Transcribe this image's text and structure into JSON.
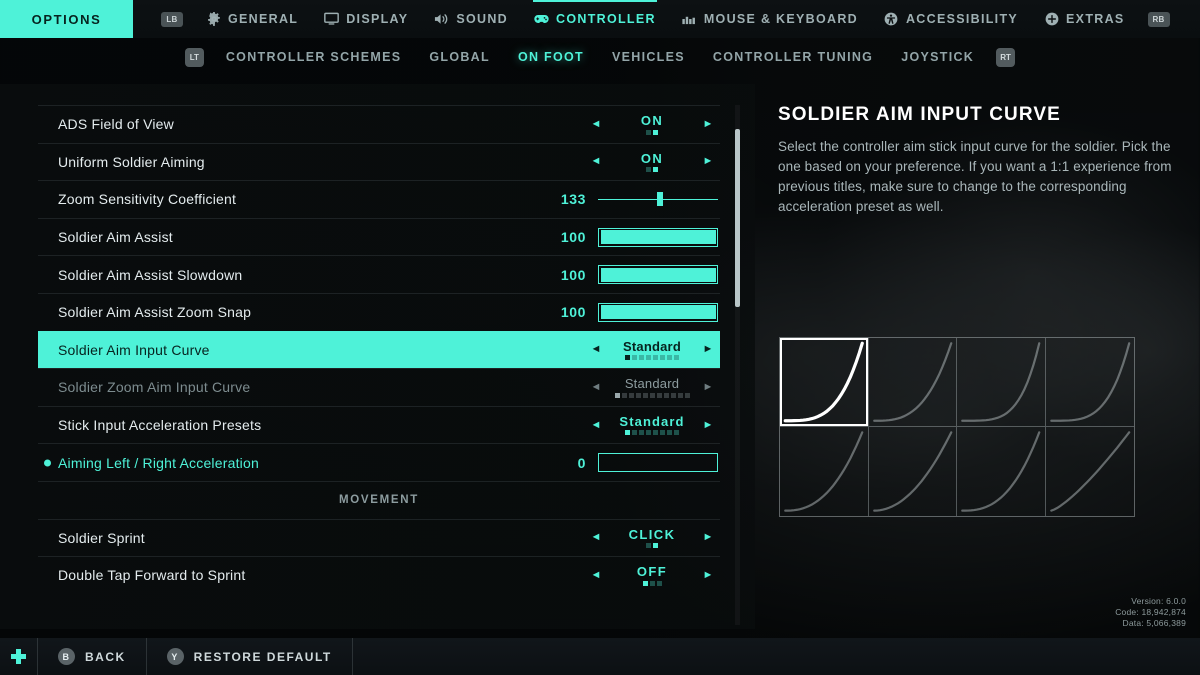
{
  "topnav": {
    "options_label": "OPTIONS",
    "left_bumper": "LB",
    "right_bumper": "RB",
    "items": [
      {
        "label": "GENERAL",
        "icon": "gear-icon",
        "active": false
      },
      {
        "label": "DISPLAY",
        "icon": "monitor-icon",
        "active": false
      },
      {
        "label": "SOUND",
        "icon": "speaker-icon",
        "active": false
      },
      {
        "label": "CONTROLLER",
        "icon": "gamepad-icon",
        "active": true
      },
      {
        "label": "MOUSE & KEYBOARD",
        "icon": "keyboard-icon",
        "active": false
      },
      {
        "label": "ACCESSIBILITY",
        "icon": "accessibility-icon",
        "active": false
      },
      {
        "label": "EXTRAS",
        "icon": "plus-circle-icon",
        "active": false
      }
    ]
  },
  "subnav": {
    "left_trigger": "LT",
    "right_trigger": "RT",
    "items": [
      {
        "label": "CONTROLLER SCHEMES",
        "active": false
      },
      {
        "label": "GLOBAL",
        "active": false
      },
      {
        "label": "ON FOOT",
        "active": true
      },
      {
        "label": "VEHICLES",
        "active": false
      },
      {
        "label": "CONTROLLER TUNING",
        "active": false
      },
      {
        "label": "JOYSTICK",
        "active": false
      }
    ]
  },
  "settings": {
    "rows": [
      {
        "type": "option",
        "label": "ADS Field of View",
        "value": "ON",
        "pips_total": 2,
        "pips_index": 1,
        "state": "normal"
      },
      {
        "type": "option",
        "label": "Uniform Soldier Aiming",
        "value": "ON",
        "pips_total": 2,
        "pips_index": 1,
        "state": "normal"
      },
      {
        "type": "slider",
        "label": "Zoom Sensitivity Coefficient",
        "value": "133",
        "percent": 52,
        "state": "normal"
      },
      {
        "type": "meter",
        "label": "Soldier Aim Assist",
        "value": "100",
        "percent": 100,
        "state": "normal"
      },
      {
        "type": "meter",
        "label": "Soldier Aim Assist Slowdown",
        "value": "100",
        "percent": 100,
        "state": "normal"
      },
      {
        "type": "meter",
        "label": "Soldier Aim Assist Zoom Snap",
        "value": "100",
        "percent": 100,
        "state": "normal"
      },
      {
        "type": "option",
        "label": "Soldier Aim Input Curve",
        "value": "Standard",
        "pips_total": 8,
        "pips_index": 0,
        "state": "selected"
      },
      {
        "type": "option",
        "label": "Soldier Zoom Aim Input Curve",
        "value": "Standard",
        "pips_total": 11,
        "pips_index": 0,
        "state": "dim"
      },
      {
        "type": "option",
        "label": "Stick Input Acceleration Presets",
        "value": "Standard",
        "pips_total": 8,
        "pips_index": 0,
        "state": "normal"
      },
      {
        "type": "meter",
        "label": "Aiming Left / Right Acceleration",
        "value": "0",
        "percent": 0,
        "state": "accent",
        "bullet": true
      },
      {
        "type": "section",
        "label": "MOVEMENT"
      },
      {
        "type": "option",
        "label": "Soldier Sprint",
        "value": "CLICK",
        "pips_total": 2,
        "pips_index": 1,
        "state": "normal"
      },
      {
        "type": "option",
        "label": "Double Tap Forward to Sprint",
        "value": "OFF",
        "pips_total": 3,
        "pips_index": 0,
        "state": "normal"
      }
    ]
  },
  "info": {
    "title": "SOLDIER AIM INPUT CURVE",
    "description": "Select the controller aim stick input curve for the soldier. Pick the one based on your preference. If you want a 1:1 experience from previous titles, make sure to change to the corresponding acceleration preset as well.",
    "curves": [
      {
        "name": "curve-1",
        "exponent": 3.4,
        "active": true
      },
      {
        "name": "curve-2",
        "exponent": 3.0,
        "active": false
      },
      {
        "name": "curve-3",
        "exponent": 4.2,
        "active": false
      },
      {
        "name": "curve-4",
        "exponent": 3.8,
        "active": false
      },
      {
        "name": "curve-5",
        "exponent": 2.4,
        "active": false
      },
      {
        "name": "curve-6",
        "exponent": 2.0,
        "active": false
      },
      {
        "name": "curve-7",
        "exponent": 2.6,
        "active": false
      },
      {
        "name": "curve-8",
        "exponent": 1.3,
        "active": false
      }
    ]
  },
  "version": {
    "line1": "Version: 6.0.0",
    "line2": "Code: 18,942,874",
    "line3": "Data: 5,066,389"
  },
  "bottombar": {
    "buttons": [
      {
        "glyph": "B",
        "label": "BACK"
      },
      {
        "glyph": "Y",
        "label": "RESTORE DEFAULT"
      }
    ]
  },
  "colors": {
    "accent": "#4ef2d8",
    "accent_dark": "#06231f",
    "text": "#e4ecee",
    "muted": "#8c9c9f"
  }
}
